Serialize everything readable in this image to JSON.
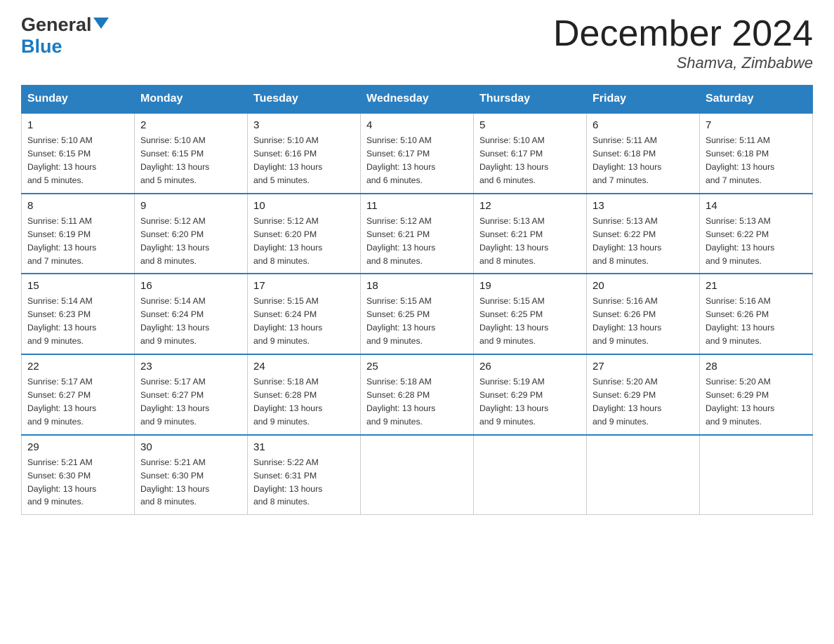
{
  "header": {
    "logo_general": "General",
    "logo_blue": "Blue",
    "month_title": "December 2024",
    "location": "Shamva, Zimbabwe"
  },
  "days_header": [
    "Sunday",
    "Monday",
    "Tuesday",
    "Wednesday",
    "Thursday",
    "Friday",
    "Saturday"
  ],
  "weeks": [
    [
      {
        "day": "1",
        "sunrise": "5:10 AM",
        "sunset": "6:15 PM",
        "daylight": "13 hours and 5 minutes."
      },
      {
        "day": "2",
        "sunrise": "5:10 AM",
        "sunset": "6:15 PM",
        "daylight": "13 hours and 5 minutes."
      },
      {
        "day": "3",
        "sunrise": "5:10 AM",
        "sunset": "6:16 PM",
        "daylight": "13 hours and 5 minutes."
      },
      {
        "day": "4",
        "sunrise": "5:10 AM",
        "sunset": "6:17 PM",
        "daylight": "13 hours and 6 minutes."
      },
      {
        "day": "5",
        "sunrise": "5:10 AM",
        "sunset": "6:17 PM",
        "daylight": "13 hours and 6 minutes."
      },
      {
        "day": "6",
        "sunrise": "5:11 AM",
        "sunset": "6:18 PM",
        "daylight": "13 hours and 7 minutes."
      },
      {
        "day": "7",
        "sunrise": "5:11 AM",
        "sunset": "6:18 PM",
        "daylight": "13 hours and 7 minutes."
      }
    ],
    [
      {
        "day": "8",
        "sunrise": "5:11 AM",
        "sunset": "6:19 PM",
        "daylight": "13 hours and 7 minutes."
      },
      {
        "day": "9",
        "sunrise": "5:12 AM",
        "sunset": "6:20 PM",
        "daylight": "13 hours and 8 minutes."
      },
      {
        "day": "10",
        "sunrise": "5:12 AM",
        "sunset": "6:20 PM",
        "daylight": "13 hours and 8 minutes."
      },
      {
        "day": "11",
        "sunrise": "5:12 AM",
        "sunset": "6:21 PM",
        "daylight": "13 hours and 8 minutes."
      },
      {
        "day": "12",
        "sunrise": "5:13 AM",
        "sunset": "6:21 PM",
        "daylight": "13 hours and 8 minutes."
      },
      {
        "day": "13",
        "sunrise": "5:13 AM",
        "sunset": "6:22 PM",
        "daylight": "13 hours and 8 minutes."
      },
      {
        "day": "14",
        "sunrise": "5:13 AM",
        "sunset": "6:22 PM",
        "daylight": "13 hours and 9 minutes."
      }
    ],
    [
      {
        "day": "15",
        "sunrise": "5:14 AM",
        "sunset": "6:23 PM",
        "daylight": "13 hours and 9 minutes."
      },
      {
        "day": "16",
        "sunrise": "5:14 AM",
        "sunset": "6:24 PM",
        "daylight": "13 hours and 9 minutes."
      },
      {
        "day": "17",
        "sunrise": "5:15 AM",
        "sunset": "6:24 PM",
        "daylight": "13 hours and 9 minutes."
      },
      {
        "day": "18",
        "sunrise": "5:15 AM",
        "sunset": "6:25 PM",
        "daylight": "13 hours and 9 minutes."
      },
      {
        "day": "19",
        "sunrise": "5:15 AM",
        "sunset": "6:25 PM",
        "daylight": "13 hours and 9 minutes."
      },
      {
        "day": "20",
        "sunrise": "5:16 AM",
        "sunset": "6:26 PM",
        "daylight": "13 hours and 9 minutes."
      },
      {
        "day": "21",
        "sunrise": "5:16 AM",
        "sunset": "6:26 PM",
        "daylight": "13 hours and 9 minutes."
      }
    ],
    [
      {
        "day": "22",
        "sunrise": "5:17 AM",
        "sunset": "6:27 PM",
        "daylight": "13 hours and 9 minutes."
      },
      {
        "day": "23",
        "sunrise": "5:17 AM",
        "sunset": "6:27 PM",
        "daylight": "13 hours and 9 minutes."
      },
      {
        "day": "24",
        "sunrise": "5:18 AM",
        "sunset": "6:28 PM",
        "daylight": "13 hours and 9 minutes."
      },
      {
        "day": "25",
        "sunrise": "5:18 AM",
        "sunset": "6:28 PM",
        "daylight": "13 hours and 9 minutes."
      },
      {
        "day": "26",
        "sunrise": "5:19 AM",
        "sunset": "6:29 PM",
        "daylight": "13 hours and 9 minutes."
      },
      {
        "day": "27",
        "sunrise": "5:20 AM",
        "sunset": "6:29 PM",
        "daylight": "13 hours and 9 minutes."
      },
      {
        "day": "28",
        "sunrise": "5:20 AM",
        "sunset": "6:29 PM",
        "daylight": "13 hours and 9 minutes."
      }
    ],
    [
      {
        "day": "29",
        "sunrise": "5:21 AM",
        "sunset": "6:30 PM",
        "daylight": "13 hours and 9 minutes."
      },
      {
        "day": "30",
        "sunrise": "5:21 AM",
        "sunset": "6:30 PM",
        "daylight": "13 hours and 8 minutes."
      },
      {
        "day": "31",
        "sunrise": "5:22 AM",
        "sunset": "6:31 PM",
        "daylight": "13 hours and 8 minutes."
      },
      null,
      null,
      null,
      null
    ]
  ],
  "labels": {
    "sunrise": "Sunrise:",
    "sunset": "Sunset:",
    "daylight": "Daylight:"
  }
}
